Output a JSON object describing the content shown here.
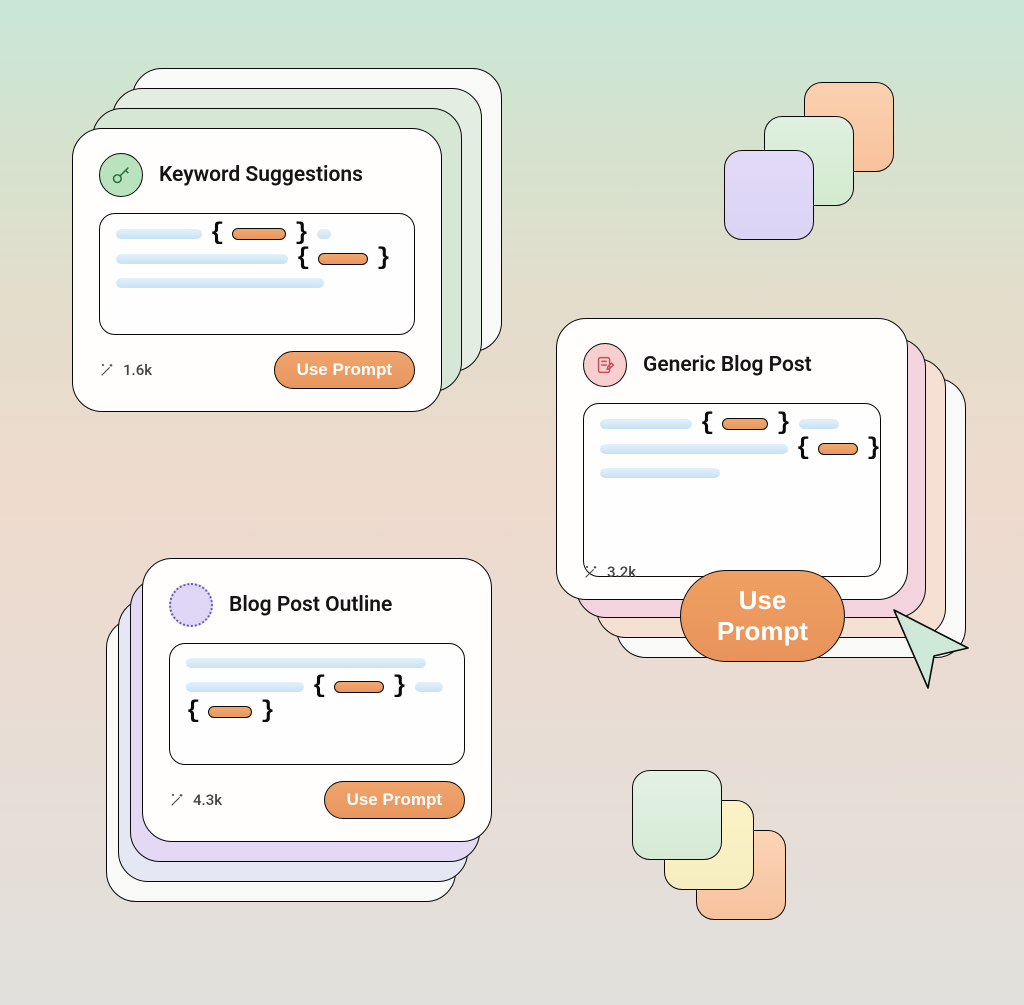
{
  "cards": {
    "keyword": {
      "title": "Keyword Suggestions",
      "count": "1.6k",
      "button": "Use Prompt"
    },
    "blog": {
      "title": "Generic Blog Post",
      "count": "3.2k",
      "button": "Use Prompt"
    },
    "outline": {
      "title": "Blog Post Outline",
      "count": "4.3k",
      "button": "Use Prompt"
    }
  }
}
